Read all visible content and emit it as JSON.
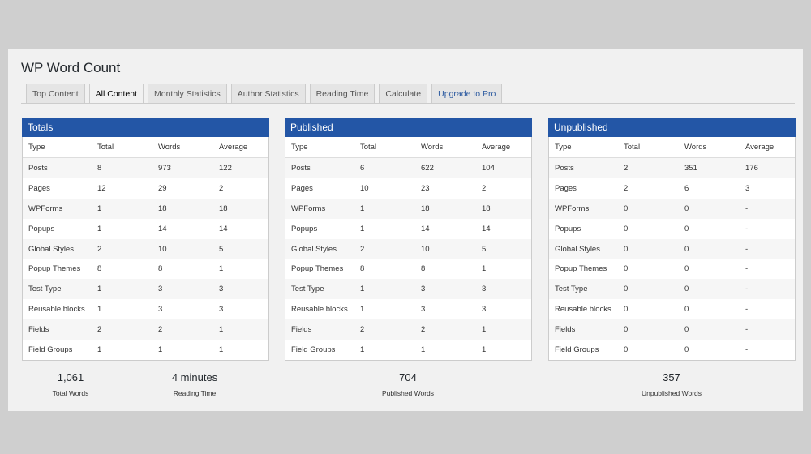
{
  "app": {
    "title": "WP Word Count"
  },
  "tabs": [
    {
      "label": "Top Content"
    },
    {
      "label": "All Content",
      "active": true
    },
    {
      "label": "Monthly Statistics"
    },
    {
      "label": "Author Statistics"
    },
    {
      "label": "Reading Time"
    },
    {
      "label": "Calculate"
    },
    {
      "label": "Upgrade to Pro"
    }
  ],
  "columns": [
    "Type",
    "Total",
    "Words",
    "Average"
  ],
  "panels": [
    {
      "title": "Totals",
      "rows": [
        [
          "Posts",
          "8",
          "973",
          "122"
        ],
        [
          "Pages",
          "12",
          "29",
          "2"
        ],
        [
          "WPForms",
          "1",
          "18",
          "18"
        ],
        [
          "Popups",
          "1",
          "14",
          "14"
        ],
        [
          "Global Styles",
          "2",
          "10",
          "5"
        ],
        [
          "Popup Themes",
          "8",
          "8",
          "1"
        ],
        [
          "Test Type",
          "1",
          "3",
          "3"
        ],
        [
          "Reusable blocks",
          "1",
          "3",
          "3"
        ],
        [
          "Fields",
          "2",
          "2",
          "1"
        ],
        [
          "Field Groups",
          "1",
          "1",
          "1"
        ]
      ]
    },
    {
      "title": "Published",
      "rows": [
        [
          "Posts",
          "6",
          "622",
          "104"
        ],
        [
          "Pages",
          "10",
          "23",
          "2"
        ],
        [
          "WPForms",
          "1",
          "18",
          "18"
        ],
        [
          "Popups",
          "1",
          "14",
          "14"
        ],
        [
          "Global Styles",
          "2",
          "10",
          "5"
        ],
        [
          "Popup Themes",
          "8",
          "8",
          "1"
        ],
        [
          "Test Type",
          "1",
          "3",
          "3"
        ],
        [
          "Reusable blocks",
          "1",
          "3",
          "3"
        ],
        [
          "Fields",
          "2",
          "2",
          "1"
        ],
        [
          "Field Groups",
          "1",
          "1",
          "1"
        ]
      ]
    },
    {
      "title": "Unpublished",
      "rows": [
        [
          "Posts",
          "2",
          "351",
          "176"
        ],
        [
          "Pages",
          "2",
          "6",
          "3"
        ],
        [
          "WPForms",
          "0",
          "0",
          "-"
        ],
        [
          "Popups",
          "0",
          "0",
          "-"
        ],
        [
          "Global Styles",
          "0",
          "0",
          "-"
        ],
        [
          "Popup Themes",
          "0",
          "0",
          "-"
        ],
        [
          "Test Type",
          "0",
          "0",
          "-"
        ],
        [
          "Reusable blocks",
          "0",
          "0",
          "-"
        ],
        [
          "Fields",
          "0",
          "0",
          "-"
        ],
        [
          "Field Groups",
          "0",
          "0",
          "-"
        ]
      ]
    }
  ],
  "summary": {
    "total_words": {
      "value": "1,061",
      "label": "Total Words"
    },
    "reading_time": {
      "value": "4 minutes",
      "label": "Reading Time"
    },
    "published_words": {
      "value": "704",
      "label": "Published Words"
    },
    "unpublished_words": {
      "value": "357",
      "label": "Unpublished Words"
    }
  }
}
